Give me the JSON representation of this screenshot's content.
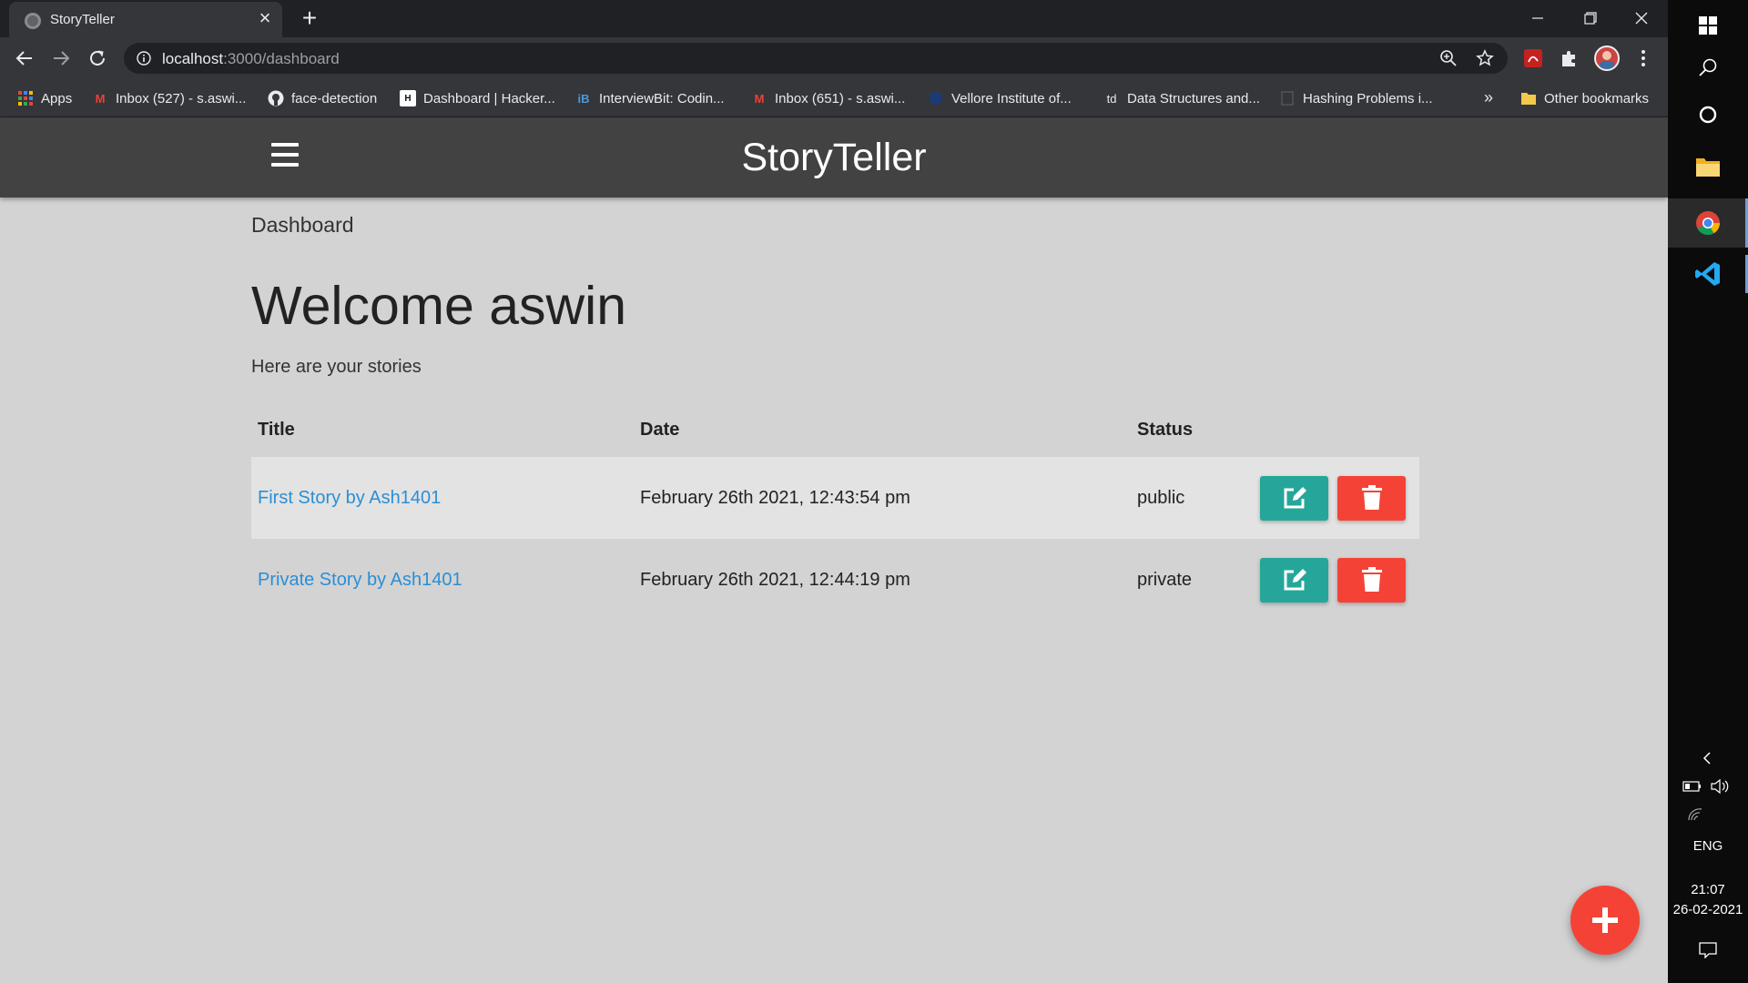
{
  "browser": {
    "tab_title": "StoryTeller",
    "url_host": "localhost",
    "url_path": ":3000/dashboard",
    "bookmarks": [
      {
        "label": "Apps",
        "icon": "apps-grid-icon"
      },
      {
        "label": "Inbox (527) - s.aswi...",
        "icon": "gmail-icon"
      },
      {
        "label": "face-detection",
        "icon": "github-icon"
      },
      {
        "label": "Dashboard | Hacker...",
        "icon": "hackerrank-icon"
      },
      {
        "label": "InterviewBit: Codin...",
        "icon": "interviewbit-icon"
      },
      {
        "label": "Inbox (651) - s.aswi...",
        "icon": "gmail-icon"
      },
      {
        "label": "Vellore Institute of...",
        "icon": "vit-icon"
      },
      {
        "label": "Data Structures and...",
        "icon": "td-icon"
      },
      {
        "label": "Hashing Problems i...",
        "icon": "page-icon"
      }
    ],
    "more_bookmarks": "»",
    "other_bookmarks": "Other bookmarks"
  },
  "app": {
    "brand": "StoryTeller",
    "breadcrumb": "Dashboard",
    "welcome": "Welcome aswin",
    "subtitle": "Here are your stories",
    "table": {
      "headers": [
        "Title",
        "Date",
        "Status"
      ],
      "rows": [
        {
          "title": "First Story by Ash1401",
          "date": "February 26th 2021, 12:43:54 pm",
          "status": "public"
        },
        {
          "title": "Private Story by Ash1401",
          "date": "February 26th 2021, 12:44:19 pm",
          "status": "private"
        }
      ]
    }
  },
  "colors": {
    "header_bg": "#424242",
    "page_bg": "#d3d3d3",
    "edit_button": "#26a69a",
    "delete_button": "#f44336",
    "link": "#2a8fd6"
  },
  "taskbar": {
    "language": "ENG",
    "time": "21:07",
    "date": "26-02-2021"
  }
}
